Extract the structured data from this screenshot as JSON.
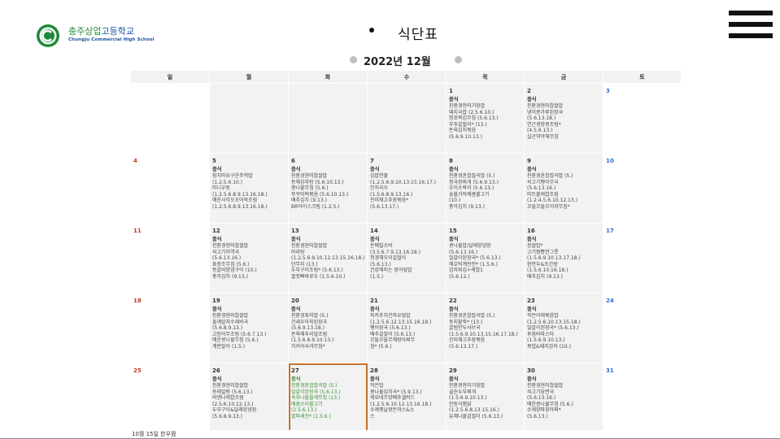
{
  "school": {
    "name_colored": "충주상업",
    "name_rest": "고등학교",
    "name_en": "Chungju Commercial High School"
  },
  "page_title": "식단표",
  "calendar": {
    "month_title": "2022년 12월",
    "day_headers": [
      "일",
      "월",
      "화",
      "수",
      "목",
      "금",
      "토"
    ],
    "weeks": [
      [
        {
          "day": "",
          "meal": "",
          "items": []
        },
        {
          "day": "",
          "meal": "",
          "items": []
        },
        {
          "day": "",
          "meal": "",
          "items": []
        },
        {
          "day": "",
          "meal": "",
          "items": []
        },
        {
          "day": "1",
          "meal": "중식",
          "items": [
            "친환경현미기장밥",
            "돼지국밥 (2.5.6.10.)",
            "청포묵김무침 (5.6.13.)",
            "부추겉절이* (13.)",
            "돈육김치볶음",
            "(5.6.9.10.13.)"
          ]
        },
        {
          "day": "2",
          "meal": "중식",
          "items": [
            "친환경현미찹쌀밥",
            "냉이콩가루된장국",
            "(5.6.13.18.)",
            "연근생땅콩조림*",
            "(4.5.6.13.)",
            "실곤약야채무침"
          ]
        },
        {
          "day": "3",
          "meal": "",
          "items": []
        }
      ],
      [
        {
          "day": "4",
          "meal": "",
          "items": []
        },
        {
          "day": "5",
          "meal": "중식",
          "items": [
            "참치마요구운주먹밥",
            "(1.2.5.6.10.)",
            "미니우동",
            "(1.2.5.6.8.9.13.16.18.)",
            "매운사각오꼬어묵조림",
            "(1.2.5.6.8.9.13.16.18.)"
          ]
        },
        {
          "day": "6",
          "meal": "중식",
          "items": [
            "친환경현미찹쌀밥",
            "동해감자탕 (5.6.10.13.)",
            "콩나물무침 (5.6.)",
            "쭈꾸미떡볶음 (5.6.10.13.)",
            "배추김치 (9.13.)",
            "BR아이스크림 (1.2.5.)"
          ]
        },
        {
          "day": "7",
          "meal": "중식",
          "items": [
            "김밥한줄",
            "(1.2.5.6.9.10.13.15.16.17.)",
            "잔치국수",
            "(1.5.6.8.9.13.16.)",
            "진미채고추장볶음*",
            "(5.6.13.17.)"
          ]
        },
        {
          "day": "8",
          "meal": "중식",
          "items": [
            "친환경혼합잡곡밥 (5.)",
            "청국장찌개 (5.6.9.13.)",
            "오이소박이 (5.6.13.)",
            "숯불가득매콤불고기",
            "(10.)",
            "총각김치 (9.13.)"
          ]
        },
        {
          "day": "9",
          "meal": "중식",
          "items": [
            "친환경혼합잡곡밥 (5.)",
            "쇠고기팽이무국",
            "(5.6.13.16.)",
            "미트볼케찹조림",
            "(1.2.4.5.6.10.12.13.)",
            "꼬들꼬들오이지무침*"
          ]
        },
        {
          "day": "10",
          "meal": "",
          "items": []
        }
      ],
      [
        {
          "day": "11",
          "meal": "",
          "items": []
        },
        {
          "day": "12",
          "meal": "중식",
          "items": [
            "친환경현미찹쌀밥",
            "쇠고기미역국",
            "(5.6.13.16.)",
            "표장조무침 (5.6.)",
            "동갈비양념구이 (10.)",
            "총각김치 (9.13.)"
          ]
        },
        {
          "day": "13",
          "meal": "중식",
          "items": [
            "친환경현미찹쌀밥",
            "마라탕",
            "(1.2.5.6.9.10.12.13.15.16.18.)",
            "단무지 (13.)",
            "두부구이조림* (5.6.13.)",
            "꿀짓빠바로우 (1.5.6.10.)"
          ]
        },
        {
          "day": "14",
          "meal": "중식",
          "items": [
            "온메밀소바",
            "(3.5.6.7.9.13.16.18.)",
            "청경채오이겉절이",
            "(5.6.13.)",
            "건강해지는 장어덮밥",
            "(1.5.)"
          ]
        },
        {
          "day": "15",
          "meal": "중식",
          "items": [
            "콩나물밥/달래양념장",
            "(5.6.13.16.)",
            "얼갈이된장국* (5.6.13.)",
            "애호박계란전* (1.5.6.)",
            "감자튀김+케찹1",
            "(5.6.12.)"
          ]
        },
        {
          "day": "16",
          "meal": "중식",
          "items": [
            "흰쌀밥*",
            "고기짬뽕한그릇",
            "(1.5.6.9.10.13.17.18.)",
            "현만두&조간장",
            "(1.5.6.10.16.18.)",
            "배추김치 (9.13.)"
          ]
        },
        {
          "day": "17",
          "meal": "",
          "items": []
        }
      ],
      [
        {
          "day": "18",
          "meal": "",
          "items": []
        },
        {
          "day": "19",
          "meal": "중식",
          "items": [
            "친환경현미찹쌀밥",
            "들깨알자수제비국",
            "(5.6.8.9.13.)",
            "고등어무조림 (5.6.7.13.)",
            "매운콩나물무침 (5.6.)",
            "계란말이 (1.5.)"
          ]
        },
        {
          "day": "20",
          "meal": "중식",
          "items": [
            "친환경흑미밥 (5.)",
            "건새우아욱된장국",
            "(5.6.9.13.18.)",
            "돈육메추리알조림",
            "(1.5.6.8.9.10.13.)",
            "치커리사과무침*"
          ]
        },
        {
          "day": "21",
          "meal": "중식",
          "items": [
            "피카추치킨마요덮밥",
            "(1.2.5.6.12.13.15.16.18.)",
            "팽이장국 (5.6.13.)",
            "배추겉절이 (5.6.13.)",
            "꼬들꼬들무채장아찌무",
            "침* (5.6.)"
          ]
        },
        {
          "day": "22",
          "meal": "중식",
          "items": [
            "친환경혼합잡곡밥 (5.)",
            "동지팥죽* (13.)",
            "굴림만두사브국",
            "(1.5.6.9.10.13.15.16.17.18.)",
            "진미채고추장볶음",
            "(5.6.13.17.)"
          ]
        },
        {
          "day": "23",
          "meal": "중식",
          "items": [
            "작은야채볶음밥",
            "(1.2.5.6.10.13.15.18.)",
            "얼갈이된장국* (5.6.13.)",
            "투움바파스타",
            "(1.5.6.9.10.13.)",
            "볶힙&돼지감자 (10.)"
          ]
        },
        {
          "day": "24",
          "meal": "",
          "items": []
        }
      ],
      [
        {
          "day": "25",
          "meal": "",
          "items": []
        },
        {
          "day": "26",
          "meal": "중식",
          "items": [
            "친환경현미찹쌀밥",
            "동태알탕 (5.6.13.)",
            "비엔나케찹조림",
            "(2.5.6.10.12.13.)",
            "두부구이&달래양념장",
            "(5.6.8.9.13.)"
          ]
        },
        {
          "day": "27",
          "meal": "중식",
          "items": [
            "친환경혼합잡곡밥 (5.)",
            "얼갈이된장국 (5.6.13.)",
            "숙주나물들깨무침 (13.)",
            "매콤오리불고기",
            "(2.5.6.13.)",
            "꿀파래전* (1.5.6.)"
          ]
        },
        {
          "day": "28",
          "meal": "중식",
          "items": [
            "작은밥",
            "콩나물김치국* (5.9.13.)",
            "케요네즈양배추샐러드",
            "(1.2.5.6.10.12.13.16.18.)",
            "수제옛날왕돈까스&소",
            "스"
          ]
        },
        {
          "day": "29",
          "meal": "중식",
          "items": [
            "친환경현미기장밥",
            "골순두부찌개",
            "(1.5.6.9.10.13.)",
            "안동식찜닭",
            "(1.2.5.6.8.13.15.16.)",
            "유채나물겉절이 (5.6.13.)"
          ]
        },
        {
          "day": "30",
          "meal": "중식",
          "items": [
            "친환경현미찹쌀밥",
            "쇠고기당면국",
            "(5.6.13.16.)",
            "매운콩나물무침 (5.6.)",
            "수제양파장아찌*",
            "(5.6.13.)"
          ]
        },
        {
          "day": "31",
          "meal": "",
          "items": []
        }
      ]
    ]
  },
  "footer_partial": "10월 15일 한우짬",
  "colors": {
    "accent_green": "#3a8e3a",
    "today_border": "#c8702a",
    "sunday": "#c0392b",
    "saturday": "#2e6fd0",
    "cell_bg": "#f2f2f2"
  }
}
